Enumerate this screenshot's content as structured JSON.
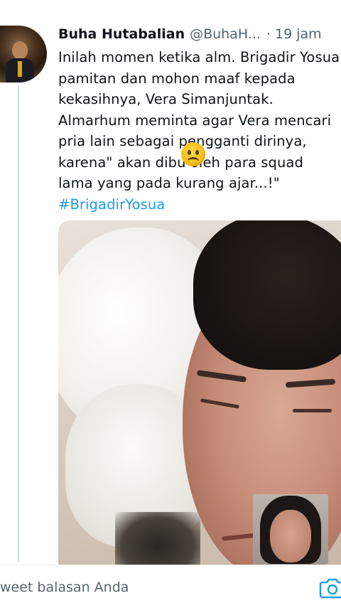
{
  "tweet": {
    "author_name": "Buha Hutabalian",
    "author_handle": "@BuhaH...",
    "separator": "·",
    "time": "19 jam",
    "lines": [
      "Inilah momen ketika alm. Brigadir Yosua",
      "pamitan dan mohon maaf kepada",
      "kekasihnya, Vera Simanjuntak.",
      "Almarhum meminta agar Vera mencari",
      "pria lain sebagai pengganti dirinya,",
      "karena\" akan dibu    oleh para squad",
      "lama yang pada kurang ajar...!\""
    ],
    "hashtag": "#BrigadirYosua",
    "emoji": "frowning-face-emoji"
  },
  "reply": {
    "placeholder": "weet balasan Anda",
    "camera_icon": "camera-icon"
  },
  "colors": {
    "link": "#1d9bf0",
    "secondary_text": "#536471",
    "thread_line": "#cfd9de"
  }
}
